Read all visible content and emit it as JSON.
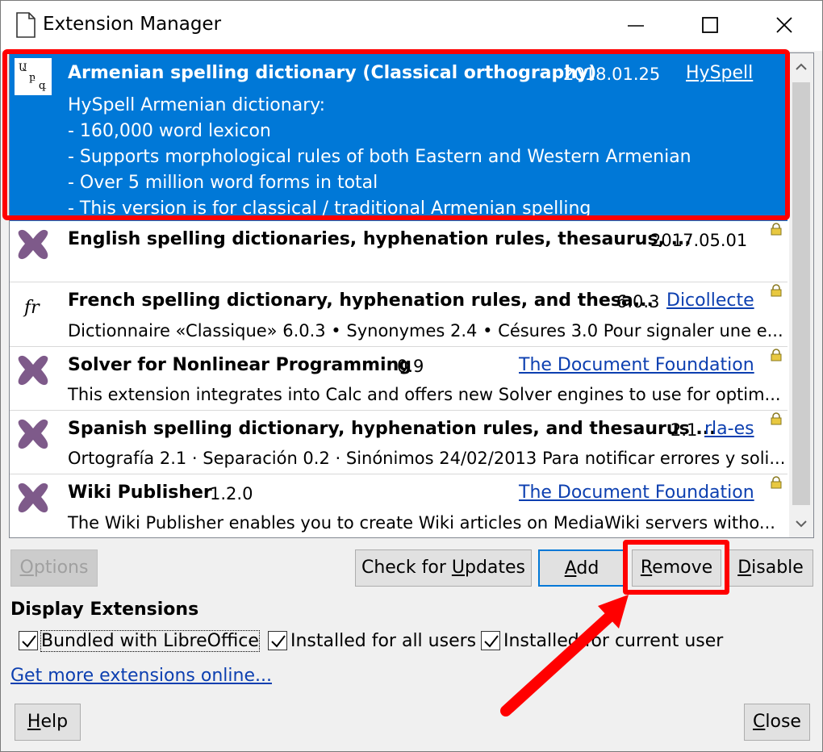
{
  "window": {
    "title": "Extension Manager"
  },
  "extensions": [
    {
      "name": "Armenian spelling dictionary (Classical orthography)",
      "version": "2018.01.25",
      "publisher": "HySpell",
      "icon": "armenian-letters-icon",
      "selected": true,
      "description_lines": [
        "HySpell Armenian dictionary:",
        "- 160,000 word lexicon",
        "- Supports morphological rules of both Eastern and Western Armenian",
        "- Over 5 million word forms in total",
        "- This version is for classical / traditional Armenian spelling"
      ]
    },
    {
      "name": "English spelling dictionaries, hyphenation rules, thesaurus, ...",
      "version": "2017.05.01",
      "publisher": "",
      "icon": "puzzle-piece-icon",
      "locked": true,
      "description": ""
    },
    {
      "name": "French spelling dictionary, hyphenation rules, and thesa...",
      "version": "6.0.3",
      "publisher": "Dicollecte",
      "icon": "fr-text-icon",
      "locked": true,
      "description": "Dictionnaire «Classique» 6.0.3 • Synonymes 2.4 • Césures 3.0   Pour signaler une e..."
    },
    {
      "name": "Solver for Nonlinear Programming",
      "version": "0.9",
      "publisher": "The Document Foundation",
      "icon": "puzzle-piece-icon",
      "locked": true,
      "description": "This extension integrates into Calc and offers new Solver engines to use for optim..."
    },
    {
      "name": "Spanish spelling dictionary, hyphenation rules, and thesaurus ...",
      "version": "2.1",
      "publisher": "rla-es",
      "icon": "puzzle-piece-icon",
      "locked": true,
      "description": "Ortografía 2.1 · Separación 0.2 · Sinónimos 24/02/2013  Para notificar errores y soli..."
    },
    {
      "name": "Wiki Publisher",
      "version": "1.2.0",
      "publisher": "The Document Foundation",
      "icon": "puzzle-piece-icon",
      "locked": true,
      "description": "The Wiki Publisher enables you to create Wiki articles on MediaWiki servers witho..."
    }
  ],
  "buttons": {
    "options": "Options",
    "check_updates": "Check for Updates",
    "add": "Add",
    "remove": "Remove",
    "disable": "Disable",
    "help": "Help",
    "close": "Close"
  },
  "display_extensions": {
    "label": "Display Extensions",
    "bundled": "Bundled with LibreOffice",
    "all_users": "Installed for all users",
    "current_user": "Installed for current user"
  },
  "get_more_link": "Get more extensions online...",
  "colors": {
    "selection": "#0078d7",
    "link": "#0c3fb0",
    "highlight": "#ff0000",
    "puzzle": "#7e5a8a"
  }
}
